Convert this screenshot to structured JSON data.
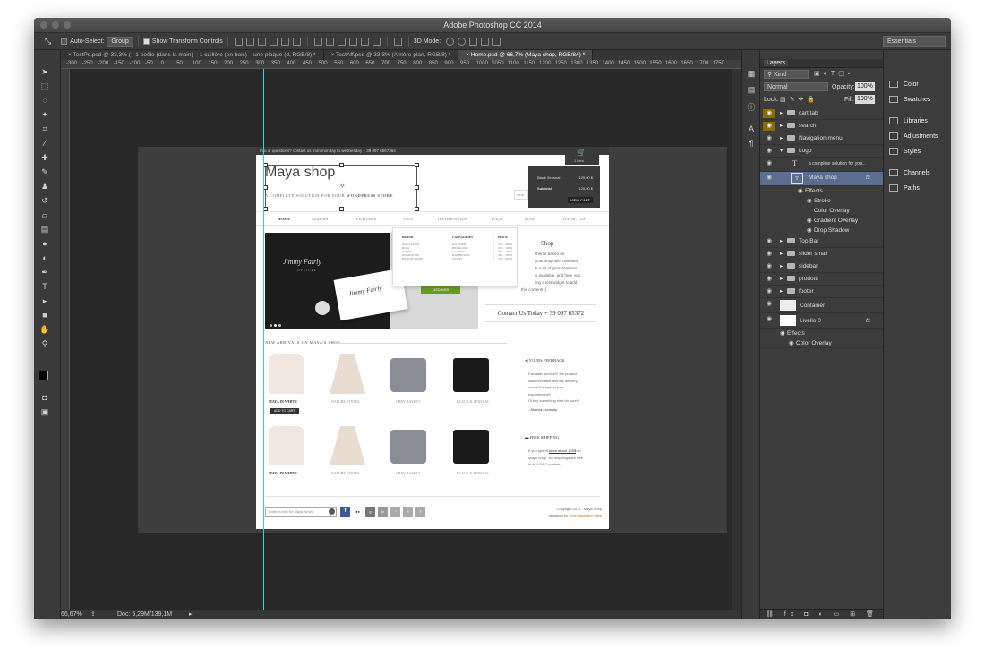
{
  "app": {
    "title": "Adobe Photoshop CC 2014",
    "workspace": "Essentials"
  },
  "options": {
    "auto_select": "Auto-Select:",
    "group": "Group",
    "transform": "Show Transform Controls",
    "mode3d": "3D Mode:"
  },
  "tabs": [
    {
      "label": "TestPs.psd @ 33,3% (– 1 poêle (dans la main) – 1 cuillère (en bois) – une plaque (d, RGB/8) *"
    },
    {
      "label": "TestAff.psd @ 33,3% (Arrière-plan, RGB/8) *"
    },
    {
      "label": "Home.psd @ 66,7% (Maya shop, RGB/8#) *"
    }
  ],
  "ruler_ticks": [
    "-300",
    "-250",
    "-200",
    "-150",
    "-100",
    "-50",
    "0",
    "50",
    "100",
    "150",
    "200",
    "250",
    "300",
    "350",
    "400",
    "450",
    "500",
    "550",
    "600",
    "650",
    "700",
    "750",
    "800",
    "850",
    "900",
    "950",
    "1000",
    "1050",
    "1100",
    "1150",
    "1200",
    "1250",
    "1300",
    "1350",
    "1400",
    "1450",
    "1500",
    "1550",
    "1600",
    "1650",
    "1700",
    "1750"
  ],
  "status": {
    "zoom": "66,67%",
    "doc": "Doc: 5,29M/139,1M"
  },
  "layers_panel": {
    "title": "Layers",
    "kind": "Kind",
    "blend": "Normal",
    "opacity_label": "Opacity:",
    "opacity": "100%",
    "lock_label": "Lock:",
    "fill_label": "Fill:",
    "fill": "100%",
    "rows": [
      "cart tab",
      "search",
      "Navigation menu",
      "Logo",
      "a complete solution for you...",
      "Maya shop",
      "Effects",
      "Stroke",
      "Color Overlay",
      "Gradient Overlay",
      "Drop Shadow",
      "Top Bar",
      "slider small",
      "sidebar",
      "prodotti",
      "footer",
      "Container",
      "Livello 0",
      "Effects",
      "Color Overlay"
    ]
  },
  "right_panel": [
    "Color",
    "Swatches",
    "Libraries",
    "Adjustments",
    "Styles",
    "Channels",
    "Paths"
  ],
  "site": {
    "topbar": "Info or questions? contact us from monday to wednesday + 39 097 6567364",
    "logo": "Maya shop",
    "tagline_a": "A COMPLETE SOLUTION FOR YOUR",
    "tagline_b": "WORDPRESS STORE",
    "cart": {
      "items": "1 item",
      "row1_label": "Black Sensual",
      "row1_val": "125,00 $",
      "row2_label": "Subtotal",
      "row2_val": "125,00 $",
      "button": "VIEW CART"
    },
    "search_placeholder": "Sear",
    "nav": [
      "HOME",
      "SLIDERS",
      "FEATURES",
      "SHOP",
      "TESTIMONIALS",
      "FAQS",
      "BLOG",
      "CONTACT US"
    ],
    "mega": {
      "brand_title": "BRAND",
      "brand": [
        "WALLMART",
        "IKEA",
        "PATRIS",
        "HOMESHOP",
        "BRAND NAME"
      ],
      "cat_title": "CATEGORIES",
      "cats": [
        "KITCHEN",
        "BEDROOM",
        "GARDEN",
        "BATHROOM",
        "WOOD"
      ],
      "price_title": "PRICE",
      "prices": [
        "100 - 200 $",
        "200 - 300 $",
        "300 - 400 $",
        "400 - 500 $",
        "700 - 900 $"
      ]
    },
    "slider_brand": "Jimmy Fairly",
    "slider_sub": "OPTICAL",
    "slider_btn": "DISCOVER",
    "intro_title": "Shop",
    "intro": [
      "theme based on",
      "your shop with unlimited",
      "h a lot of great features.",
      "s available, and here you",
      "ing a text widget to add",
      "this content! :)"
    ],
    "contact": "Contact Us Today + 39 097 65372",
    "arrivals": "NEW ARRIVALS ON MAYA'S SHOP",
    "products": [
      "MAYA IN WHITE",
      "NATURE STYLES",
      "GREY BASKET",
      "BLACK & SENSUAL"
    ],
    "add_to_cart": "ADD TO CART",
    "feedback_title": "YOURS FEEDBACK",
    "feedback": [
      "Fantastic service!!! the product",
      "was incredible and the delivery",
      "one of the fastest ever",
      "experienced!!!",
      "I'll buy something else for sure!!!"
    ],
    "feedback_author": "- Monica Levinsky",
    "shipping_title": "FREE SHIPPING",
    "shipping_a": "If you spend",
    "shipping_link": "more about 100$",
    "shipping_b": "on",
    "shipping_c": "Maya Shop, the shippings are free",
    "shipping_d": "in all USA Countries!",
    "newsletter": "Enter e-mail for Maya News",
    "copyright": "Copyright 2011 - Maya Shop",
    "designed": "designed by",
    "designer": "Your Inspiration Web"
  }
}
